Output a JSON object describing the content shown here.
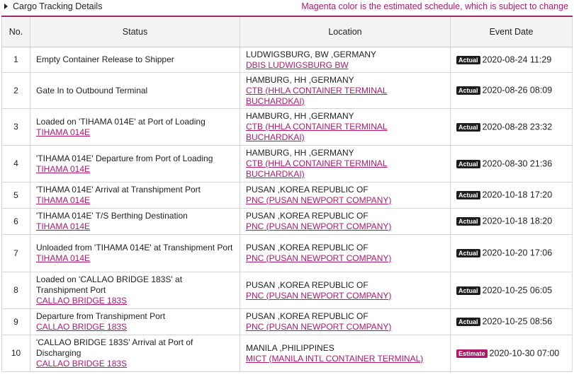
{
  "header": {
    "title": "Cargo Tracking Details",
    "note": "Magenta color is the estimated schedule, which is subject to change"
  },
  "columns": {
    "no": "No.",
    "status": "Status",
    "location": "Location",
    "date": "Event Date"
  },
  "colors": {
    "accent": "#b0186e",
    "actual_badge": "#1e1e1e"
  },
  "rows": [
    {
      "no": "1",
      "status": "Empty Container Release to Shipper",
      "vessel": "",
      "city": "LUDWIGSBURG, BW ,GERMANY",
      "terminal": "DBIS LUDWIGSBURG BW",
      "badge": "Actual",
      "date": "2020-08-24 11:29"
    },
    {
      "no": "2",
      "status": "Gate In to Outbound Terminal",
      "vessel": "",
      "city": "HAMBURG, HH ,GERMANY",
      "terminal": "CTB (HHLA CONTAINER TERMINAL BUCHARDKAI)",
      "badge": "Actual",
      "date": "2020-08-26 08:09"
    },
    {
      "no": "3",
      "status": "Loaded on 'TIHAMA 014E' at Port of Loading",
      "vessel": "TIHAMA 014E",
      "city": "HAMBURG, HH ,GERMANY",
      "terminal": "CTB (HHLA CONTAINER TERMINAL BUCHARDKAI)",
      "badge": "Actual",
      "date": "2020-08-28 23:32"
    },
    {
      "no": "4",
      "status": "'TIHAMA 014E' Departure from Port of Loading",
      "vessel": "TIHAMA 014E",
      "city": "HAMBURG, HH ,GERMANY",
      "terminal": "CTB (HHLA CONTAINER TERMINAL BUCHARDKAI)",
      "badge": "Actual",
      "date": "2020-08-30 21:36"
    },
    {
      "no": "5",
      "status": "'TIHAMA 014E' Arrival at Transhipment Port",
      "vessel": "TIHAMA 014E",
      "city": "PUSAN ,KOREA REPUBLIC OF",
      "terminal": "PNC (PUSAN NEWPORT COMPANY)",
      "badge": "Actual",
      "date": "2020-10-18 17:20"
    },
    {
      "no": "6",
      "status": "'TIHAMA 014E' T/S Berthing Destination",
      "vessel": "TIHAMA 014E",
      "city": "PUSAN ,KOREA REPUBLIC OF",
      "terminal": "PNC (PUSAN NEWPORT COMPANY)",
      "badge": "Actual",
      "date": "2020-10-18 18:20"
    },
    {
      "no": "7",
      "status": "Unloaded from 'TIHAMA 014E' at Transhipment Port",
      "vessel": "TIHAMA 014E",
      "city": "PUSAN ,KOREA REPUBLIC OF",
      "terminal": "PNC (PUSAN NEWPORT COMPANY)",
      "badge": "Actual",
      "date": "2020-10-20 17:06"
    },
    {
      "no": "8",
      "status": "Loaded on 'CALLAO BRIDGE 183S' at Transhipment Port",
      "vessel": "CALLAO BRIDGE 183S",
      "city": "PUSAN ,KOREA REPUBLIC OF",
      "terminal": "PNC (PUSAN NEWPORT COMPANY)",
      "badge": "Actual",
      "date": "2020-10-25 06:05"
    },
    {
      "no": "9",
      "status": "Departure from Transhipment Port",
      "vessel": "CALLAO BRIDGE 183S",
      "city": "PUSAN ,KOREA REPUBLIC OF",
      "terminal": "PNC (PUSAN NEWPORT COMPANY)",
      "badge": "Actual",
      "date": "2020-10-25 08:56"
    },
    {
      "no": "10",
      "status": "'CALLAO BRIDGE 183S' Arrival at Port of Discharging",
      "vessel": "CALLAO BRIDGE 183S",
      "city": "MANILA ,PHILIPPINES",
      "terminal": "MICT (MANILA INTL CONTAINER TERMINAL)",
      "badge": "Estimate",
      "date": "2020-10-30 07:00"
    }
  ]
}
